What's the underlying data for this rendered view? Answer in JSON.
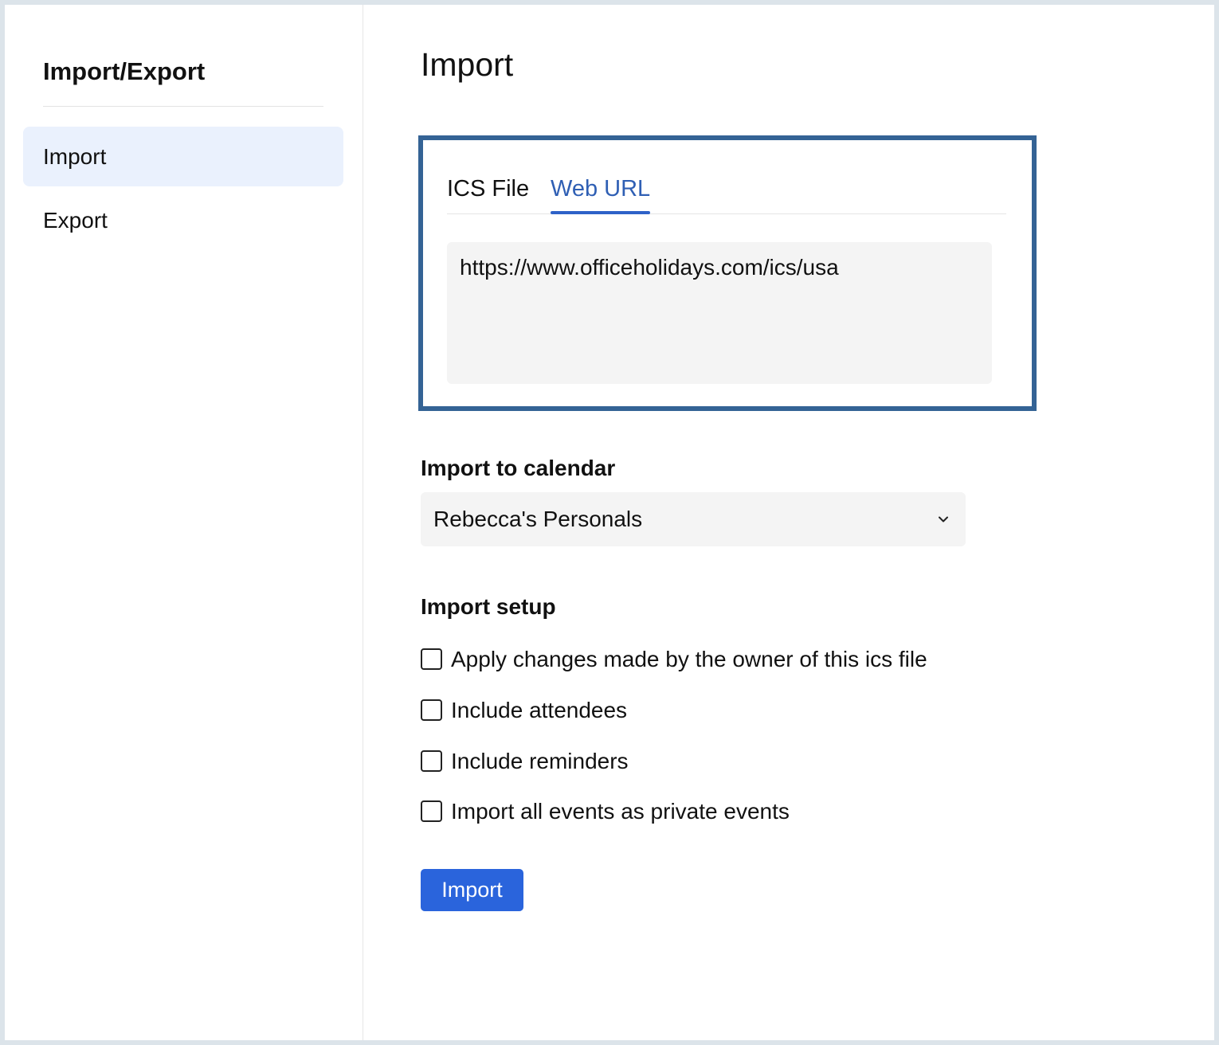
{
  "sidebar": {
    "title": "Import/Export",
    "items": [
      {
        "label": "Import",
        "active": true
      },
      {
        "label": "Export",
        "active": false
      }
    ]
  },
  "main": {
    "title": "Import",
    "tabs": [
      {
        "label": "ICS File",
        "selected": false
      },
      {
        "label": "Web URL",
        "selected": true
      }
    ],
    "url_value": "https://www.officeholidays.com/ics/usa",
    "calendar": {
      "label": "Import to calendar",
      "selected": "Rebecca's Personals"
    },
    "setup": {
      "label": "Import setup",
      "options": [
        {
          "label": "Apply changes made by the owner of this ics file",
          "checked": false
        },
        {
          "label": "Include attendees",
          "checked": false
        },
        {
          "label": "Include reminders",
          "checked": false
        },
        {
          "label": "Import all events as private events",
          "checked": false
        }
      ]
    },
    "import_button": "Import"
  },
  "colors": {
    "accent": "#2a64dc",
    "tab_active": "#2f5fb4",
    "highlight_border": "#346395",
    "nav_active_bg": "#eaf1fd",
    "field_bg": "#f4f4f4"
  },
  "icons": {
    "dropdown": "chevron-down-icon"
  }
}
